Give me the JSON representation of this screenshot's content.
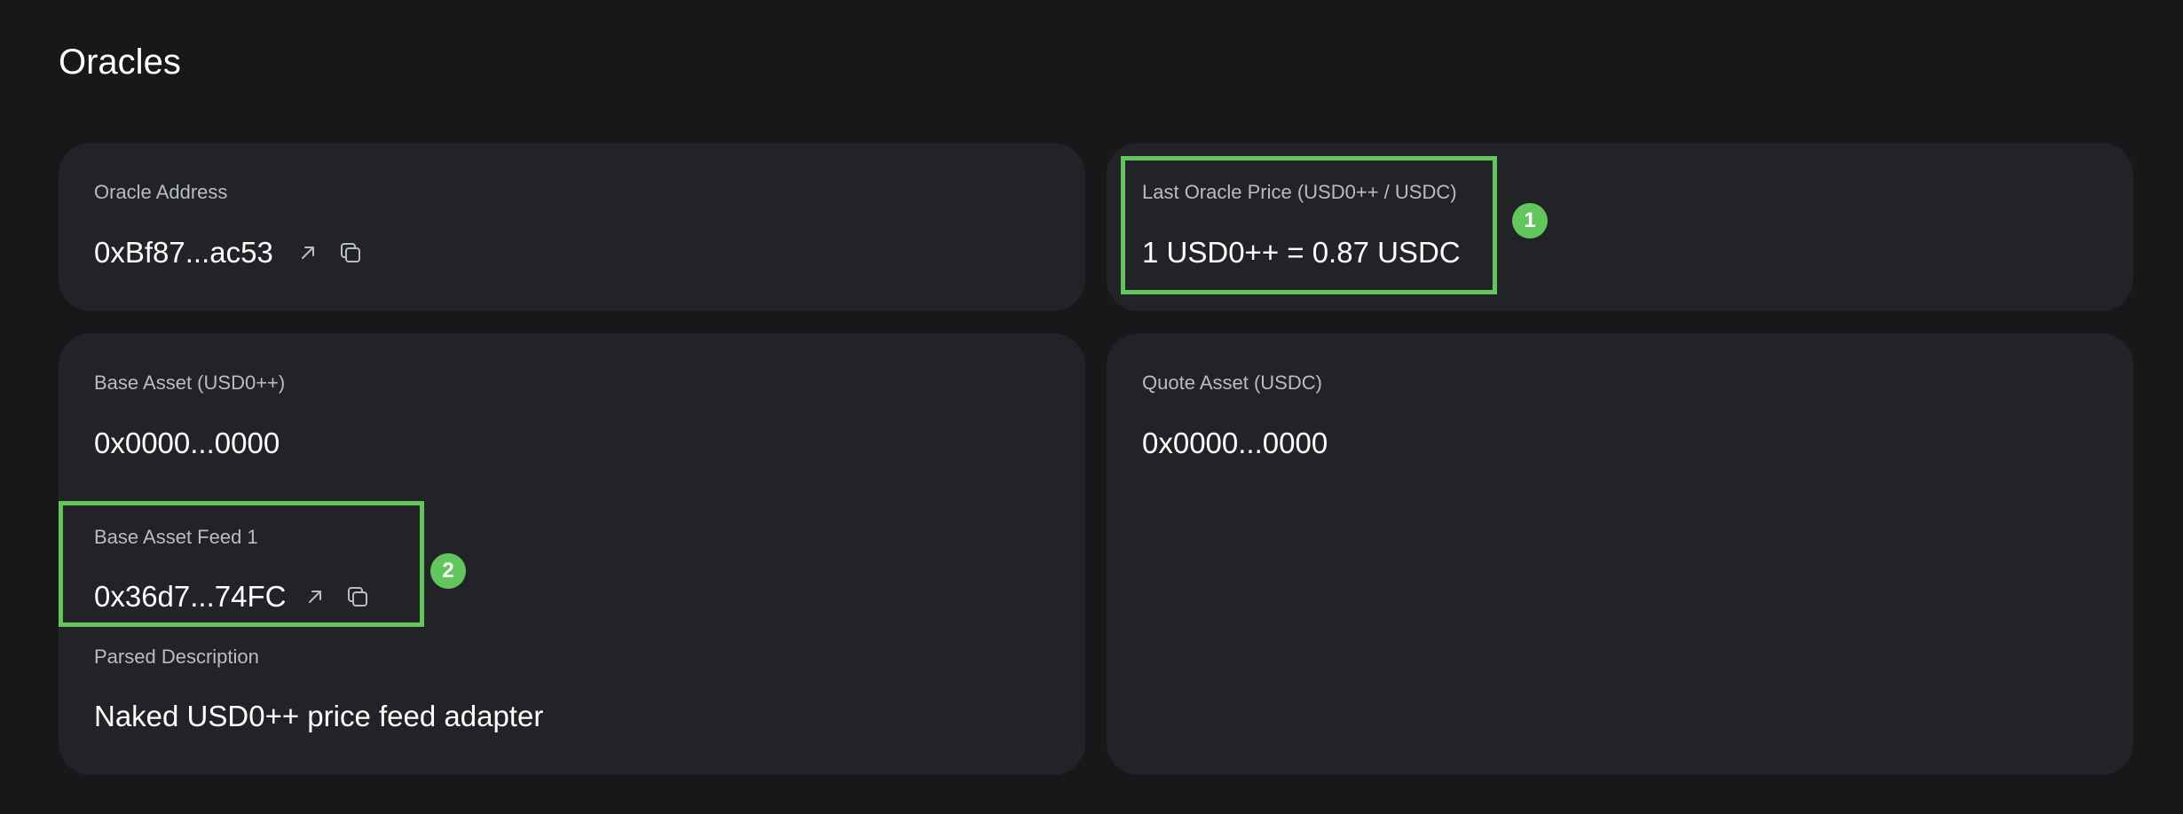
{
  "page": {
    "title": "Oracles"
  },
  "oracle_address": {
    "label": "Oracle Address",
    "value": "0xBf87...ac53",
    "icons": [
      "external-link-icon",
      "copy-icon"
    ]
  },
  "last_oracle_price": {
    "label": "Last Oracle Price (USD0++ / USDC)",
    "value": "1 USD0++ = 0.87 USDC"
  },
  "base_asset": {
    "label": "Base Asset (USD0++)",
    "value": "0x0000...0000",
    "feed": {
      "label": "Base Asset Feed 1",
      "value": "0x36d7...74FC",
      "icons": [
        "external-link-icon",
        "copy-icon"
      ]
    },
    "parsed_description": {
      "label": "Parsed Description",
      "value": "Naked USD0++ price feed adapter"
    }
  },
  "quote_asset": {
    "label": "Quote Asset (USDC)",
    "value": "0x0000...0000"
  },
  "annotations": {
    "marker_1": "1",
    "marker_2": "2",
    "color": "#62c65c"
  },
  "colors": {
    "background": "#17181a",
    "card": "#222327",
    "label": "#b9bcc2",
    "value": "#ffffff"
  }
}
